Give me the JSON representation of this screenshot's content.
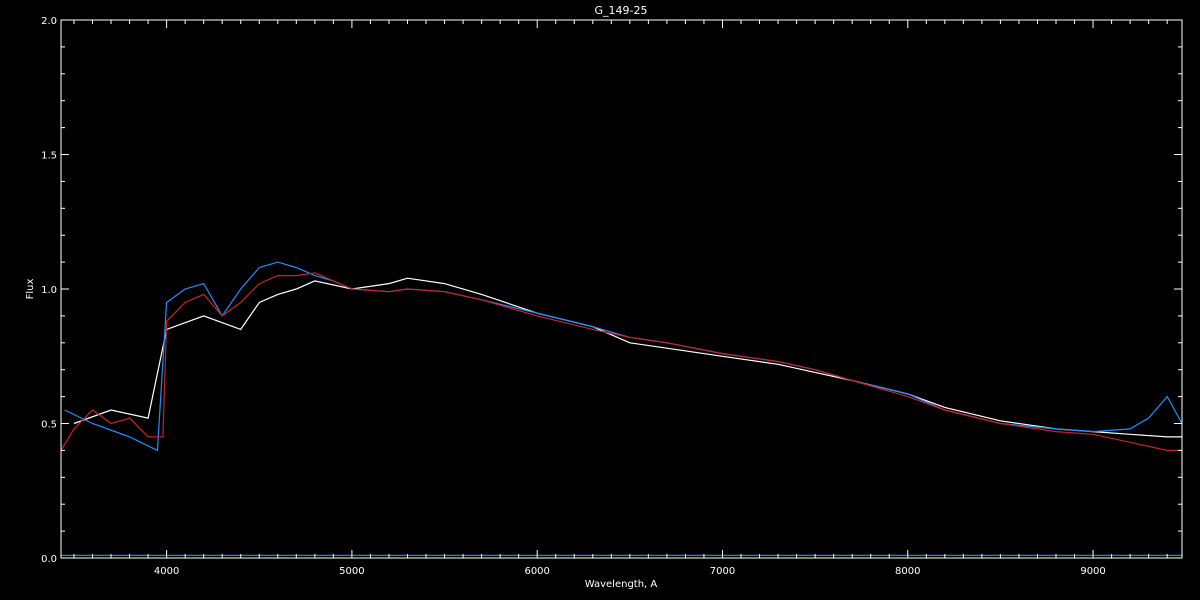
{
  "chart_data": {
    "type": "line",
    "title": "G_149-25",
    "xlabel": "Wavelength, A",
    "ylabel": "Flux",
    "xlim": [
      3430,
      9480
    ],
    "ylim": [
      0.0,
      2.0
    ],
    "x_ticks": [
      4000,
      5000,
      6000,
      7000,
      8000,
      9000
    ],
    "x_tick_labels": [
      "4000",
      "5000",
      "6000",
      "7000",
      "8000",
      "9000"
    ],
    "y_ticks": [
      0.0,
      0.5,
      1.0,
      1.5,
      2.0
    ],
    "y_tick_labels": [
      "0.0",
      "0.5",
      "1.0",
      "1.5",
      "2.0"
    ],
    "grid": false,
    "legend": false,
    "background_color": "#000000",
    "axis_color": "#ffffff",
    "series": [
      {
        "color": "#ffffff",
        "x": [
          3500,
          3700,
          3900,
          4000,
          4200,
          4400,
          4500,
          4600,
          4700,
          4800,
          5000,
          5200,
          5300,
          5500,
          5700,
          6000,
          6300,
          6500,
          6700,
          7000,
          7300,
          7500,
          7700,
          8000,
          8200,
          8500,
          8800,
          9000,
          9200,
          9400,
          9480
        ],
        "y": [
          0.5,
          0.55,
          0.52,
          0.85,
          0.9,
          0.85,
          0.95,
          0.98,
          1.0,
          1.03,
          1.0,
          1.02,
          1.04,
          1.02,
          0.98,
          0.91,
          0.86,
          0.8,
          0.78,
          0.75,
          0.72,
          0.69,
          0.66,
          0.61,
          0.56,
          0.51,
          0.48,
          0.47,
          0.46,
          0.45,
          0.45
        ]
      },
      {
        "color": "#1e8fff",
        "x": [
          3450,
          3600,
          3800,
          3950,
          4000,
          4100,
          4200,
          4300,
          4400,
          4500,
          4600,
          4700,
          4800,
          4900,
          5000,
          5200,
          5300,
          5500,
          5700,
          6000,
          6300,
          6500,
          6700,
          7000,
          7300,
          7500,
          7700,
          8000,
          8200,
          8500,
          8800,
          9000,
          9200,
          9300,
          9400,
          9480
        ],
        "y": [
          0.55,
          0.5,
          0.45,
          0.4,
          0.95,
          1.0,
          1.02,
          0.9,
          1.0,
          1.08,
          1.1,
          1.08,
          1.05,
          1.03,
          1.0,
          0.99,
          1.0,
          0.99,
          0.96,
          0.91,
          0.86,
          0.82,
          0.8,
          0.76,
          0.73,
          0.7,
          0.66,
          0.61,
          0.55,
          0.5,
          0.48,
          0.47,
          0.48,
          0.52,
          0.6,
          0.5
        ]
      },
      {
        "color": "#cc2222",
        "x": [
          3430,
          3500,
          3600,
          3700,
          3800,
          3900,
          3980,
          4000,
          4100,
          4200,
          4300,
          4400,
          4500,
          4600,
          4700,
          4800,
          4900,
          5000,
          5200,
          5300,
          5500,
          5700,
          6000,
          6300,
          6500,
          6700,
          7000,
          7300,
          7500,
          7700,
          8000,
          8200,
          8500,
          8800,
          9000,
          9200,
          9400,
          9480
        ],
        "y": [
          0.4,
          0.48,
          0.55,
          0.5,
          0.52,
          0.45,
          0.45,
          0.88,
          0.95,
          0.98,
          0.9,
          0.95,
          1.02,
          1.05,
          1.05,
          1.06,
          1.03,
          1.0,
          0.99,
          1.0,
          0.99,
          0.96,
          0.9,
          0.85,
          0.82,
          0.8,
          0.76,
          0.73,
          0.7,
          0.66,
          0.6,
          0.55,
          0.5,
          0.47,
          0.46,
          0.43,
          0.4,
          0.4
        ]
      },
      {
        "color": "#1e8fff",
        "x": [
          3430,
          4000,
          5000,
          6000,
          7000,
          8000,
          9000,
          9480
        ],
        "y": [
          0.01,
          0.01,
          0.01,
          0.01,
          0.01,
          0.01,
          0.01,
          0.01
        ]
      }
    ]
  }
}
